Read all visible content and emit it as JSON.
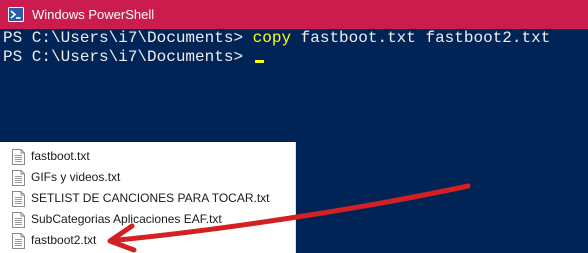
{
  "window": {
    "title": "Windows PowerShell"
  },
  "console": {
    "line1_prompt": "PS C:\\Users\\i7\\Documents> ",
    "line1_command": "copy",
    "line1_args": " fastboot.txt fastboot2.txt",
    "line2_prompt": "PS C:\\Users\\i7\\Documents> "
  },
  "file_list": {
    "items": [
      {
        "name": "fastboot.txt"
      },
      {
        "name": "GIFs y videos.txt"
      },
      {
        "name": "SETLIST DE CANCIONES PARA TOCAR.txt"
      },
      {
        "name": "SubCategorias Aplicaciones EAF.txt"
      },
      {
        "name": "fastboot2.txt"
      }
    ]
  },
  "colors": {
    "titlebar": "#cc1c4e",
    "console_bg": "#012456",
    "command": "#ffff00",
    "arrow": "#d42020"
  },
  "icons": {
    "window_icon": "powershell-icon",
    "file_icon": "text-file-icon"
  }
}
